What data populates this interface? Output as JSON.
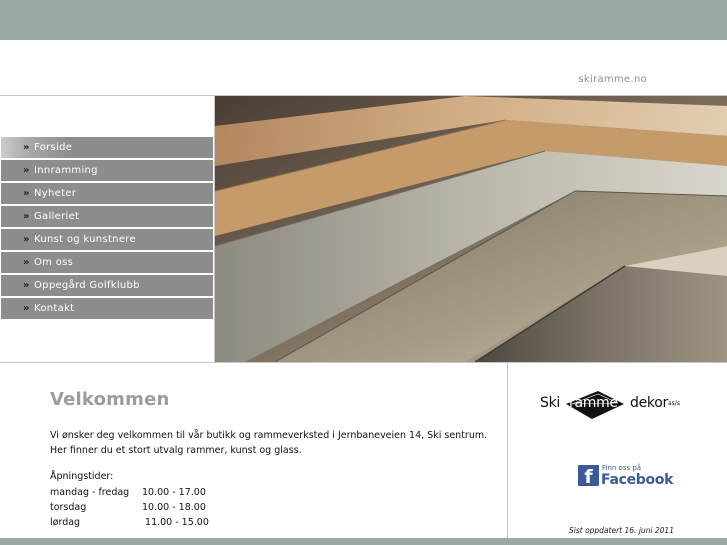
{
  "site": {
    "link_text": "skiramme.no"
  },
  "nav": {
    "items": [
      {
        "label": "Forside",
        "active": true
      },
      {
        "label": "Innramming",
        "active": false
      },
      {
        "label": "Nyheter",
        "active": false
      },
      {
        "label": "Galleriet",
        "active": false
      },
      {
        "label": "Kunst og kunstnere",
        "active": false
      },
      {
        "label": "Om oss",
        "active": false
      },
      {
        "label": "Oppegård Golfklubb",
        "active": false
      },
      {
        "label": "Kontakt",
        "active": false
      }
    ],
    "arrow": "»"
  },
  "content": {
    "title": "Velkommen",
    "intro_line1": "Vi ønsker deg velkommen til vår butikk og rammeverksted i Jernbaneveien 14, Ski sentrum.",
    "intro_line2": "Her finner du et stort utvalg rammer, kunst og glass.",
    "hours_title": "Åpningstider:",
    "hours": [
      {
        "day": "mandag - fredag",
        "time": "10.00 - 17.00"
      },
      {
        "day": "torsdag",
        "time": "10.00 - 18.00"
      },
      {
        "day": "lørdag",
        "time": " 11.00 - 15.00"
      }
    ]
  },
  "logo": {
    "left": "Ski",
    "middle": "ramme",
    "right": "dekor",
    "suffix": "as/s"
  },
  "facebook": {
    "small": "Finn oss på",
    "big": "Facebook",
    "glyph": "f"
  },
  "footer": {
    "updated": "Sist oppdatert 16. juni 2011"
  },
  "colors": {
    "bar": "#99a9a6",
    "nav": "#8d8d8d",
    "title": "#9a9d9e",
    "facebook": "#3b5998"
  }
}
